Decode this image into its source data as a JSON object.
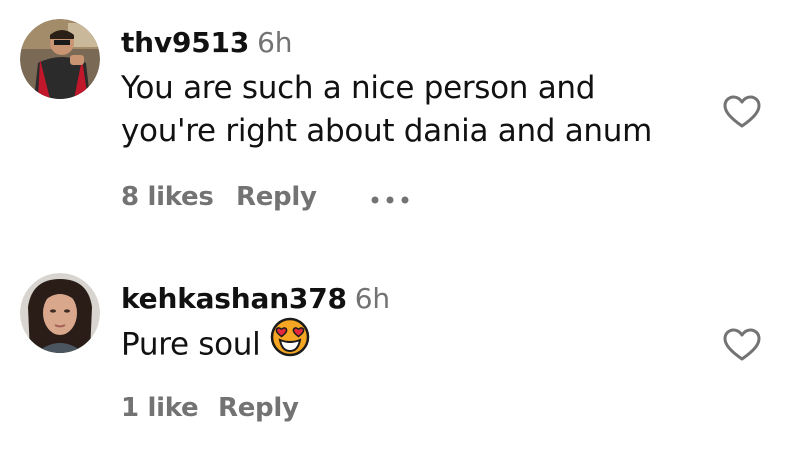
{
  "comments": [
    {
      "username": "thv9513",
      "time": "6h",
      "text_lines": [
        "You are such a nice person and",
        "you're right about dania and anum"
      ],
      "likes": "8 likes",
      "reply": "Reply",
      "more_icon": "more-horizontal-icon",
      "heart_icon": "heart-outline-icon"
    },
    {
      "username": "kehkashan378",
      "time": "6h",
      "text_lines": [
        "Pure soul"
      ],
      "emoji": "heart-eyes-emoji",
      "likes": "1 like",
      "reply": "Reply",
      "heart_icon": "heart-outline-icon"
    }
  ],
  "colors": {
    "text": "#111111",
    "secondary": "#737373",
    "background": "#ffffff",
    "emoji_face": "#f5a623",
    "emoji_heart": "#e8283b"
  }
}
